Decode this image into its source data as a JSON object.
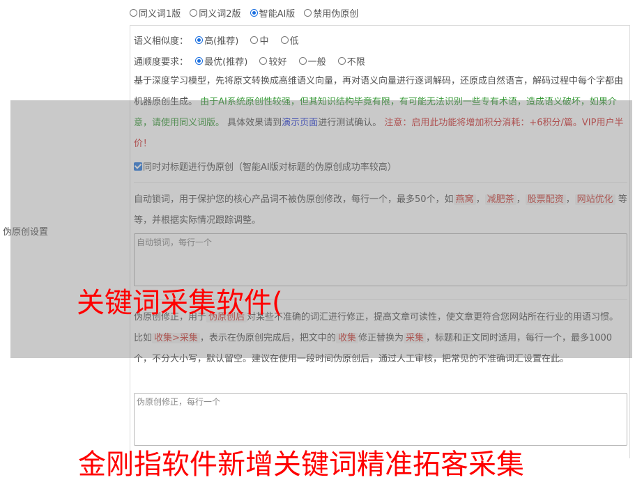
{
  "versions": [
    {
      "label": "同义词1版",
      "selected": false
    },
    {
      "label": "同义词2版",
      "selected": false
    },
    {
      "label": "智能AI版",
      "selected": true
    },
    {
      "label": "禁用伪原创",
      "selected": false
    }
  ],
  "similarity": {
    "label": "语义相似度：",
    "options": [
      {
        "label": "高(推荐)",
        "selected": true
      },
      {
        "label": "中",
        "selected": false
      },
      {
        "label": "低",
        "selected": false
      }
    ]
  },
  "fluency": {
    "label": "通顺度要求：",
    "options": [
      {
        "label": "最优(推荐)",
        "selected": true
      },
      {
        "label": "较好",
        "selected": false
      },
      {
        "label": "一般",
        "selected": false
      },
      {
        "label": "不限",
        "selected": false
      }
    ]
  },
  "description": {
    "intro": "基于深度学习模型，先将原文转换成高维语义向量，再对语义向量进行逐词解码，还原成自然语言，解码过程中每个字都由机器原创生成。",
    "warning_green": "由于AI系统原创性较强，但其知识结构毕竟有限，有可能无法识别一些专有术语，造成语义破坏，如果介意，请使用同义词版。",
    "test_prefix": "具体效果请到",
    "test_link": "演示页面",
    "test_suffix": "进行测试确认。",
    "cost_red": "注意：启用此功能将增加积分消耗：+6积分/篇。VIP用户半价！"
  },
  "title_checkbox": {
    "checked": true,
    "label": "同时对标题进行伪原创（智能AI版对标题的伪原创成功率较高）"
  },
  "lock_words": {
    "desc_prefix": "自动锁词，用于保护您的核心产品词不被伪原创修改，每行一个，最多50个，如",
    "examples": [
      "燕窝",
      "减肥茶",
      "股票配资",
      "网站优化"
    ],
    "desc_suffix": "等等，并根据实际情况跟踪调整。",
    "placeholder": "自动锁词，每行一个"
  },
  "correction": {
    "p1": "伪原创修正，用于",
    "chip1": "伪原创后",
    "p2": "对某些不准确的词汇进行修正，提高文章可读性，使文章更符合您网站所在行业的用语习惯。比如",
    "chip2": "收集>采集",
    "p3": "，表示在伪原创完成后，把文中的",
    "chip3": "收集",
    "p4": "修正替换为",
    "chip4": "采集",
    "p5": "，标题和正文同时适用，每行一个，最多1000个，不分大小写，默认留空。建议在使用一段时间伪原创后，通过人工审核，把常见的不准确词汇设置在此。",
    "placeholder": "伪原创修正，每行一个"
  },
  "side_label": "伪原创设置",
  "overlay_text_1": "关键词采集软件(",
  "overlay_text_2": "金刚指软件新增关键词精准拓客采集"
}
